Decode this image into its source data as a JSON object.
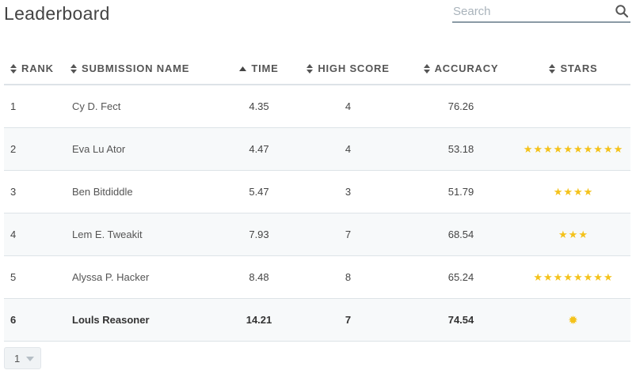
{
  "title": "Leaderboard",
  "search": {
    "placeholder": "Search",
    "value": ""
  },
  "columns": [
    {
      "key": "rank",
      "label": "RANK",
      "sort": "none"
    },
    {
      "key": "name",
      "label": "SUBMISSION NAME",
      "sort": "none"
    },
    {
      "key": "time",
      "label": "TIME",
      "sort": "asc"
    },
    {
      "key": "high_score",
      "label": "HIGH SCORE",
      "sort": "none"
    },
    {
      "key": "accuracy",
      "label": "ACCURACY",
      "sort": "none"
    },
    {
      "key": "stars",
      "label": "STARS",
      "sort": "none"
    }
  ],
  "rows": [
    {
      "rank": "1",
      "name": "Cy D. Fect",
      "time": "4.35",
      "high_score": "4",
      "accuracy": "76.26",
      "stars": 0,
      "highlight": false
    },
    {
      "rank": "2",
      "name": "Eva Lu Ator",
      "time": "4.47",
      "high_score": "4",
      "accuracy": "53.18",
      "stars": 10,
      "highlight": false
    },
    {
      "rank": "3",
      "name": "Ben Bitdiddle",
      "time": "5.47",
      "high_score": "3",
      "accuracy": "51.79",
      "stars": 4,
      "highlight": false
    },
    {
      "rank": "4",
      "name": "Lem E. Tweakit",
      "time": "7.93",
      "high_score": "7",
      "accuracy": "68.54",
      "stars": 3,
      "highlight": false
    },
    {
      "rank": "5",
      "name": "Alyssa P. Hacker",
      "time": "8.48",
      "high_score": "8",
      "accuracy": "65.24",
      "stars": 8,
      "highlight": false
    },
    {
      "rank": "6",
      "name": "Louls Reasoner",
      "time": "14.21",
      "high_score": "7",
      "accuracy": "74.54",
      "stars": 1,
      "highlight": true
    }
  ],
  "pagination": {
    "page": "1"
  },
  "colors": {
    "star": "#f4c21a",
    "row_alt": "#f7f9fa",
    "border": "#dde3e7",
    "search_underline": "#8a9aa5"
  }
}
